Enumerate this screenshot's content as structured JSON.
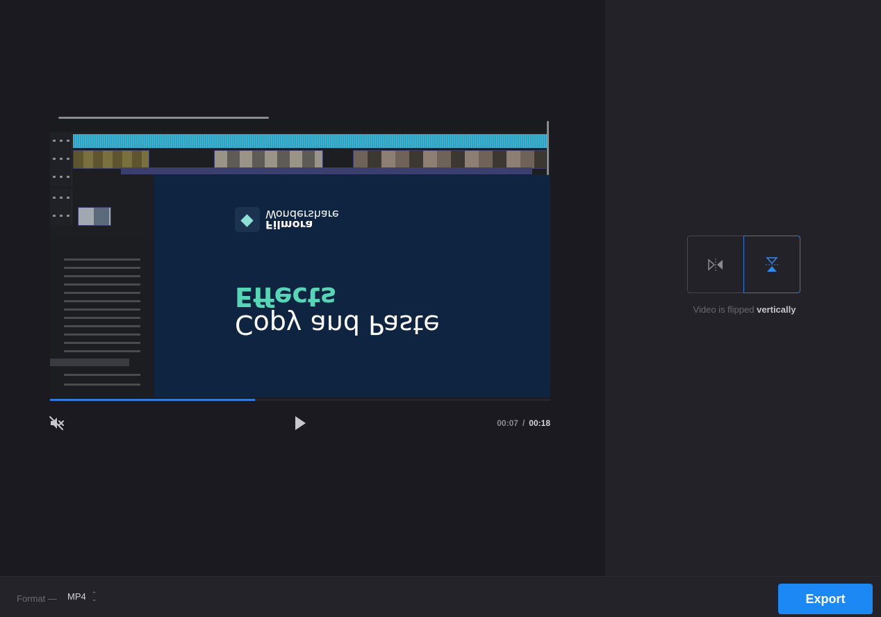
{
  "player": {
    "current_time": "00:07",
    "separator": "/",
    "total_time": "00:18",
    "progress_fraction": 0.41,
    "muted": true
  },
  "video_content": {
    "brand_line1": "Filmora",
    "brand_line2": "Wondershare",
    "title_line1": "Copy and Paste",
    "title_line2": "Effects",
    "flipped": "vertical"
  },
  "flip_panel": {
    "horizontal_icon": "flip-horizontal-icon",
    "vertical_icon": "flip-vertical-icon",
    "active": "vertical",
    "status_prefix": "Video is flipped",
    "status_value": "vertically"
  },
  "footer": {
    "format_label": "Format —",
    "format_value": "MP4",
    "export_label": "Export"
  },
  "colors": {
    "accent": "#1c88f4",
    "active_border": "#2f7bd9",
    "heading_teal": "#56d6b7",
    "slide_bg": "#0e2440"
  }
}
